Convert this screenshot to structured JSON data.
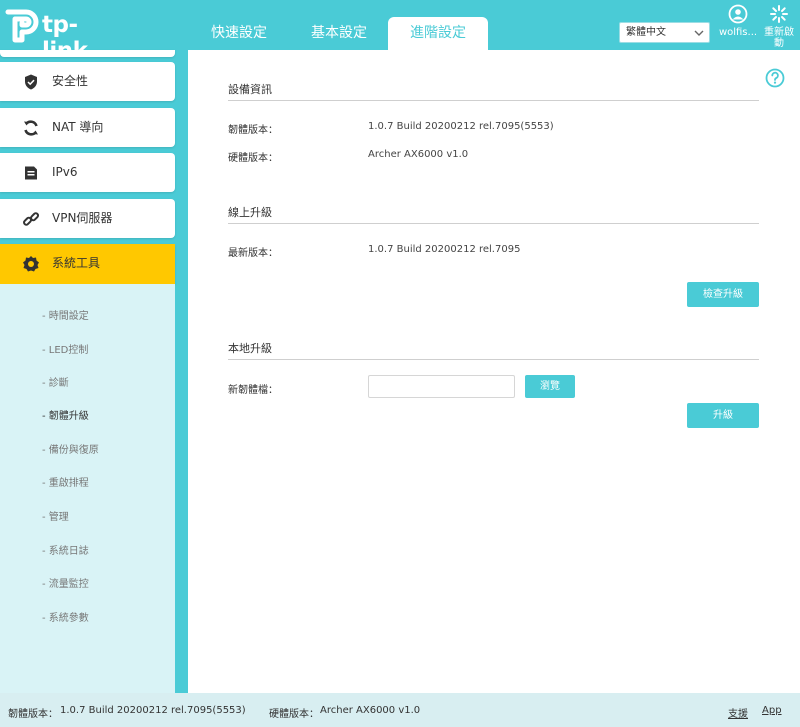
{
  "brand": {
    "logo_text": "tp-link"
  },
  "header": {
    "tabs": [
      {
        "label": "快速設定",
        "active": false
      },
      {
        "label": "基本設定",
        "active": false
      },
      {
        "label": "進階設定",
        "active": true
      }
    ],
    "language": "繁體中文",
    "user_label": "wolfis...",
    "reboot_label_line1": "重新啟",
    "reboot_label_line2": "動"
  },
  "sidebar": {
    "items": [
      {
        "label": "安全性",
        "icon": "shield-icon"
      },
      {
        "label": "NAT 導向",
        "icon": "nat-forward-icon"
      },
      {
        "label": "IPv6",
        "icon": "ipv6-icon"
      },
      {
        "label": "VPN伺服器",
        "icon": "vpn-link-icon"
      },
      {
        "label": "系統工具",
        "icon": "gear-icon",
        "active": true
      }
    ],
    "submenu": [
      {
        "label": "- 時間設定"
      },
      {
        "label": "- LED控制"
      },
      {
        "label": "- 診斷"
      },
      {
        "label": "- 韌體升級",
        "active": true
      },
      {
        "label": "- 備份與復原"
      },
      {
        "label": "- 重啟排程"
      },
      {
        "label": "- 管理"
      },
      {
        "label": "- 系統日誌"
      },
      {
        "label": "- 流量監控"
      },
      {
        "label": "- 系統參數"
      }
    ]
  },
  "device_info": {
    "title": "設備資訊",
    "firmware_label": "韌體版本：",
    "firmware_value": "1.0.7 Build 20200212 rel.7095(5553)",
    "hardware_label": "硬體版本：",
    "hardware_value": "Archer AX6000 v1.0"
  },
  "online_upgrade": {
    "title": "線上升級",
    "latest_label": "最新版本：",
    "latest_value": "1.0.7 Build 20200212 rel.7095",
    "check_button": "檢查升級"
  },
  "local_upgrade": {
    "title": "本地升級",
    "file_label": "新韌體檔：",
    "file_value": "",
    "browse_button": "瀏覽",
    "upgrade_button": "升級"
  },
  "footer": {
    "firmware_label": "韌體版本：",
    "firmware_value": "1.0.7 Build 20200212 rel.7095(5553)",
    "hardware_label": "硬體版本：",
    "hardware_value": "Archer AX6000 v1.0",
    "support_link": "支援",
    "app_link": "App"
  },
  "colors": {
    "accent": "#4acbd6",
    "active_menu": "#ffc800",
    "submenu_bg": "#d9f3f6",
    "footer_bg": "#d8eef1"
  }
}
